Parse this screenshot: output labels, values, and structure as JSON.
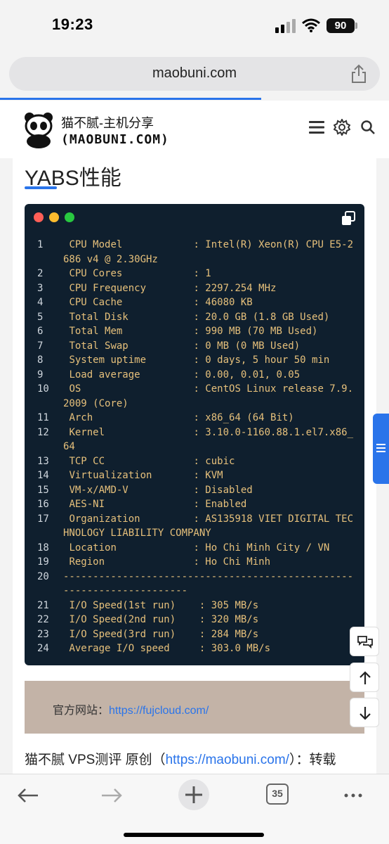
{
  "status": {
    "time": "19:23",
    "battery": "90"
  },
  "browser": {
    "url": "maobuni.com",
    "tabs_count": "35"
  },
  "site": {
    "title": "猫不腻-主机分享",
    "subtitle": "(MAOBUNI.COM)"
  },
  "article": {
    "heading": "YABS性能",
    "code_lines": [
      {
        "n": "1",
        "text": " CPU Model            : Intel(R) Xeon(R) CPU E5-2686 v4 @ 2.30GHz"
      },
      {
        "n": "2",
        "text": " CPU Cores            : 1"
      },
      {
        "n": "3",
        "text": " CPU Frequency        : 2297.254 MHz"
      },
      {
        "n": "4",
        "text": " CPU Cache            : 46080 KB"
      },
      {
        "n": "5",
        "text": " Total Disk           : 20.0 GB (1.8 GB Used)"
      },
      {
        "n": "6",
        "text": " Total Mem            : 990 MB (70 MB Used)"
      },
      {
        "n": "7",
        "text": " Total Swap           : 0 MB (0 MB Used)"
      },
      {
        "n": "8",
        "text": " System uptime        : 0 days, 5 hour 50 min"
      },
      {
        "n": "9",
        "text": " Load average         : 0.00, 0.01, 0.05"
      },
      {
        "n": "10",
        "text": " OS                   : CentOS Linux release 7.9.2009 (Core)"
      },
      {
        "n": "11",
        "text": " Arch                 : x86_64 (64 Bit)"
      },
      {
        "n": "12",
        "text": " Kernel               : 3.10.0-1160.88.1.el7.x86_64"
      },
      {
        "n": "13",
        "text": " TCP CC               : cubic"
      },
      {
        "n": "14",
        "text": " Virtualization       : KVM"
      },
      {
        "n": "15",
        "text": " VM-x/AMD-V           : Disabled"
      },
      {
        "n": "16",
        "text": " AES-NI               : Enabled"
      },
      {
        "n": "17",
        "text": " Organization         : AS135918 VIET DIGITAL TECHNOLOGY LIABILITY COMPANY"
      },
      {
        "n": "18",
        "text": " Location             : Ho Chi Minh City / VN"
      },
      {
        "n": "19",
        "text": " Region               : Ho Chi Minh"
      },
      {
        "n": "20",
        "text": "----------------------------------------------------------------------"
      },
      {
        "n": "21",
        "text": " I/O Speed(1st run)    : 305 MB/s"
      },
      {
        "n": "22",
        "text": " I/O Speed(2nd run)    : 320 MB/s"
      },
      {
        "n": "23",
        "text": " I/O Speed(3rd run)    : 284 MB/s"
      },
      {
        "n": "24",
        "text": " Average I/O speed     : 303.0 MB/s"
      }
    ],
    "official_label": "官方网站：",
    "official_link": "https://fujcloud.com/",
    "para_prefix": "猫不腻 VPS测评 原创（",
    "para_link": "https://maobuni.com/",
    "para_suffix": "）：转载"
  },
  "colors": {
    "accent": "#2a74ea",
    "code_bg": "#0f1f2e",
    "code_text": "#e6c07b",
    "info_bg": "#c3b3a7"
  }
}
